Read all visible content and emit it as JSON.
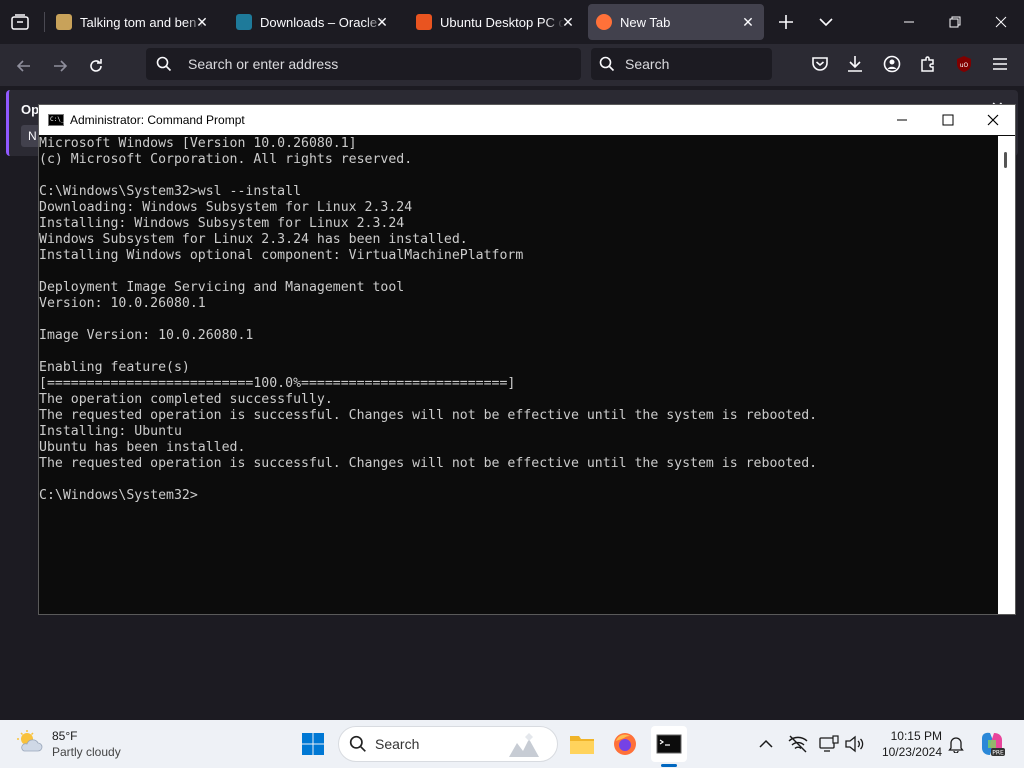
{
  "browser": {
    "tabs": [
      {
        "title": "Talking tom and ben news",
        "favicon_color": "#c8a25a",
        "active": false
      },
      {
        "title": "Downloads – Oracle VirtualBox",
        "favicon_color": "#1e7a9a",
        "active": false
      },
      {
        "title": "Ubuntu Desktop PC operating system",
        "favicon_color": "#e95420",
        "active": false
      },
      {
        "title": "New Tab",
        "favicon_color": "#ff7139",
        "active": true
      }
    ],
    "close_glyph": "✕",
    "url_placeholder": "Search or enter address",
    "search_placeholder": "Search",
    "notification": {
      "text": "Op",
      "button": "N",
      "close": "✕"
    }
  },
  "cmd": {
    "title": "Administrator: Command Prompt",
    "lines": [
      "Microsoft Windows [Version 10.0.26080.1]",
      "(c) Microsoft Corporation. All rights reserved.",
      "",
      "C:\\Windows\\System32>wsl --install",
      "Downloading: Windows Subsystem for Linux 2.3.24",
      "Installing: Windows Subsystem for Linux 2.3.24",
      "Windows Subsystem for Linux 2.3.24 has been installed.",
      "Installing Windows optional component: VirtualMachinePlatform",
      "",
      "Deployment Image Servicing and Management tool",
      "Version: 10.0.26080.1",
      "",
      "Image Version: 10.0.26080.1",
      "",
      "Enabling feature(s)",
      "[==========================100.0%==========================]",
      "The operation completed successfully.",
      "The requested operation is successful. Changes will not be effective until the system is rebooted.",
      "Installing: Ubuntu",
      "Ubuntu has been installed.",
      "The requested operation is successful. Changes will not be effective until the system is rebooted.",
      "",
      "C:\\Windows\\System32>"
    ]
  },
  "taskbar": {
    "weather_temp": "85°F",
    "weather_desc": "Partly cloudy",
    "search_placeholder": "Search",
    "time": "10:15 PM",
    "date": "10/23/2024"
  }
}
